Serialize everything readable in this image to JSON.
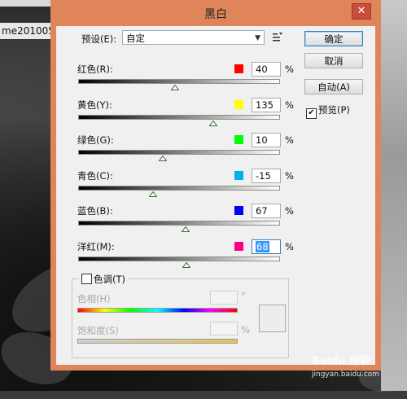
{
  "document": {
    "tab_label": "me201005"
  },
  "dialog": {
    "title": "黑白",
    "close_glyph": "✕",
    "preset": {
      "label": "预设(E):",
      "value": "自定"
    },
    "buttons": {
      "ok": "确定",
      "cancel": "取消",
      "auto": "自动(A)"
    },
    "preview": {
      "label": "预览(P)",
      "checked": true,
      "mark": "✔"
    },
    "percent_sign": "%",
    "sliders": [
      {
        "label": "红色(R):",
        "value": "40",
        "color": "#ff0000",
        "numeric": 40
      },
      {
        "label": "黄色(Y):",
        "value": "135",
        "color": "#ffff00",
        "numeric": 135
      },
      {
        "label": "绿色(G):",
        "value": "10",
        "color": "#00ff00",
        "numeric": 10
      },
      {
        "label": "青色(C):",
        "value": "-15",
        "color": "#00b0f0",
        "numeric": -15
      },
      {
        "label": "蓝色(B):",
        "value": "67",
        "color": "#0000ff",
        "numeric": 67
      },
      {
        "label": "洋红(M):",
        "value": "68",
        "color": "#ff0080",
        "numeric": 68,
        "selected": true
      }
    ],
    "slider_range": [
      -200,
      300
    ],
    "tint": {
      "label": "色调(T)",
      "checked": false,
      "hue_label": "色相(H)",
      "hue_unit": "°",
      "saturation_label": "饱和度(S)",
      "saturation_unit": "%"
    }
  },
  "watermark": {
    "brand": "Baidu 经验",
    "url": "jingyan.baidu.com"
  },
  "colors": {
    "dialog_frame": "#e0855a",
    "client_bg": "#f0f0f0",
    "close_button": "#c84d3a"
  }
}
